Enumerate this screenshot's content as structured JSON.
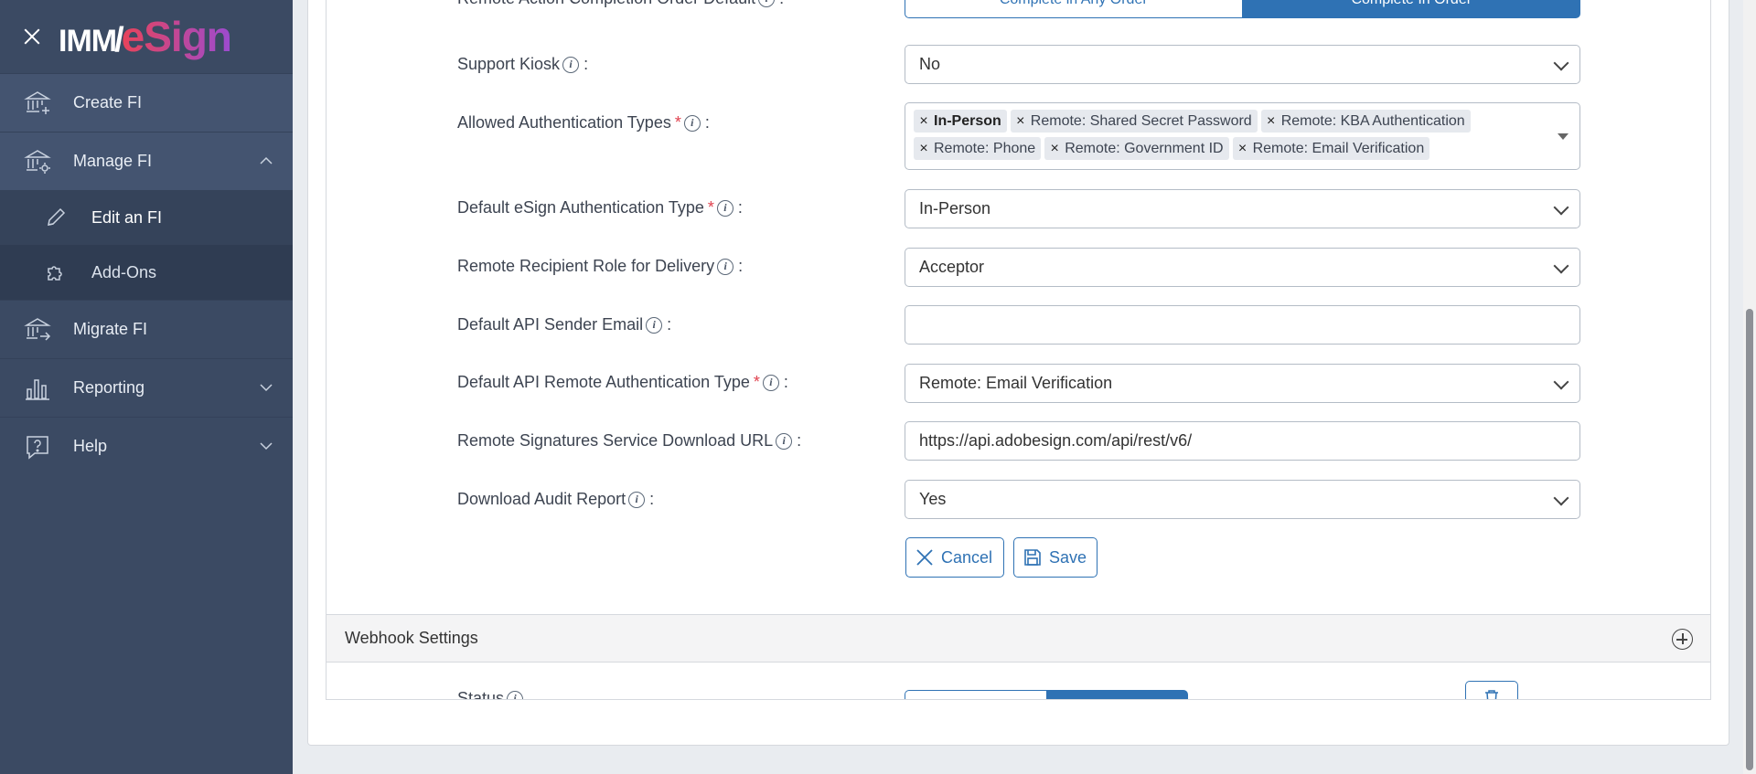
{
  "brand": {
    "imm": "IMM",
    "slash": "/",
    "esign": "eSign"
  },
  "sidebar": {
    "items": [
      {
        "label": "Create FI"
      },
      {
        "label": "Manage FI"
      },
      {
        "label": "Edit an FI"
      },
      {
        "label": "Add-Ons"
      },
      {
        "label": "Migrate FI"
      },
      {
        "label": "Reporting"
      },
      {
        "label": "Help"
      }
    ]
  },
  "form": {
    "completion_order": {
      "label": "Remote Action Completion Order Default",
      "option_any": "Complete in Any Order",
      "option_in_order": "Complete In Order"
    },
    "support_kiosk": {
      "label": "Support Kiosk",
      "value": "No"
    },
    "allowed_auth": {
      "label": "Allowed Authentication Types",
      "chips": [
        "In-Person",
        "Remote: Shared Secret Password",
        "Remote: KBA Authentication",
        "Remote: Phone",
        "Remote: Government ID",
        "Remote: Email Verification"
      ],
      "remove_glyph": "×"
    },
    "default_esign_auth": {
      "label": "Default eSign Authentication Type",
      "value": "In-Person"
    },
    "recipient_role": {
      "label": "Remote Recipient Role for Delivery",
      "value": "Acceptor"
    },
    "api_sender_email": {
      "label": "Default API Sender Email",
      "value": ""
    },
    "api_remote_auth": {
      "label": "Default API Remote Authentication Type",
      "value": "Remote: Email Verification"
    },
    "download_url": {
      "label": "Remote Signatures Service Download URL",
      "value": "https://api.adobesign.com/api/rest/v6/"
    },
    "audit_report": {
      "label": "Download Audit Report",
      "value": "Yes"
    },
    "cancel_label": "Cancel",
    "save_label": "Save",
    "colon": ":",
    "required_mark": "*",
    "info_glyph": "i"
  },
  "webhook": {
    "title": "Webhook Settings",
    "status_label": "Status"
  },
  "colors": {
    "sidebar": "#3b4a63",
    "accent": "#2f72b4",
    "required": "#e0424f",
    "esign_gradient_start": "#e8435a",
    "esign_gradient_end": "#9c4bd0"
  }
}
